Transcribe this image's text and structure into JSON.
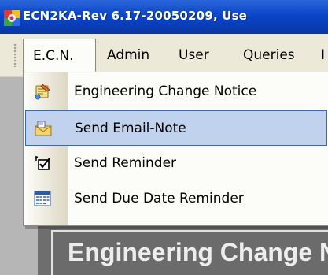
{
  "window": {
    "title": "ECN2KA-Rev 6.17-20050209, Use"
  },
  "menubar": {
    "items": [
      {
        "label": "E.C.N.",
        "state": "open"
      },
      {
        "label": "Admin"
      },
      {
        "label": "User"
      },
      {
        "label": "Queries"
      },
      {
        "label": "I"
      }
    ]
  },
  "dropdown": {
    "items": [
      {
        "label": "Engineering Change Notice",
        "icon": "engineering-change-icon"
      },
      {
        "label": "Send Email-Note",
        "icon": "email-note-icon",
        "highlighted": true
      },
      {
        "label": "Send Reminder",
        "icon": "reminder-checkbox-icon"
      },
      {
        "label": "Send Due Date Reminder",
        "icon": "calendar-icon"
      }
    ]
  },
  "background": {
    "heading": "Engineering Change N"
  },
  "colors": {
    "titlebar": "#0a46c8",
    "menu_bg": "#ece9d8",
    "highlight_bg": "#c1d2ee",
    "highlight_border": "#316ac5"
  }
}
